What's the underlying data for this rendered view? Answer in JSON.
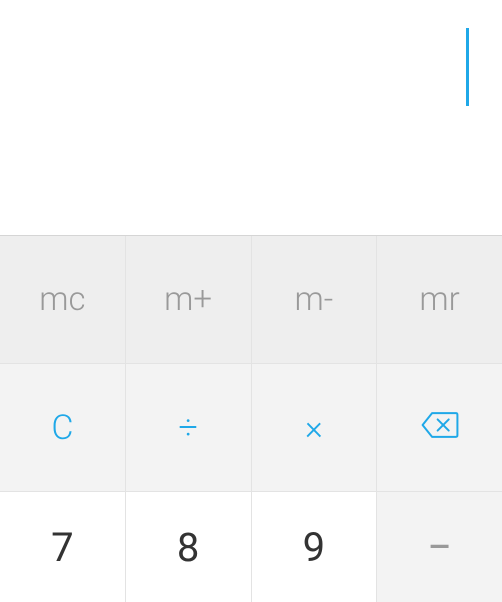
{
  "display": {
    "value": ""
  },
  "memory": {
    "mc": "mc",
    "mplus": "m+",
    "mminus": "m-",
    "mr": "mr"
  },
  "ops": {
    "clear": "C",
    "divide": "÷",
    "multiply": "×"
  },
  "digits": {
    "d7": "7",
    "d8": "8",
    "d9": "9",
    "minus": "−"
  },
  "colors": {
    "accent": "#1fa8e8",
    "muted": "#999999",
    "text": "#333333",
    "key_bg_memory": "#eeeeee",
    "key_bg_ops": "#f3f3f3"
  }
}
